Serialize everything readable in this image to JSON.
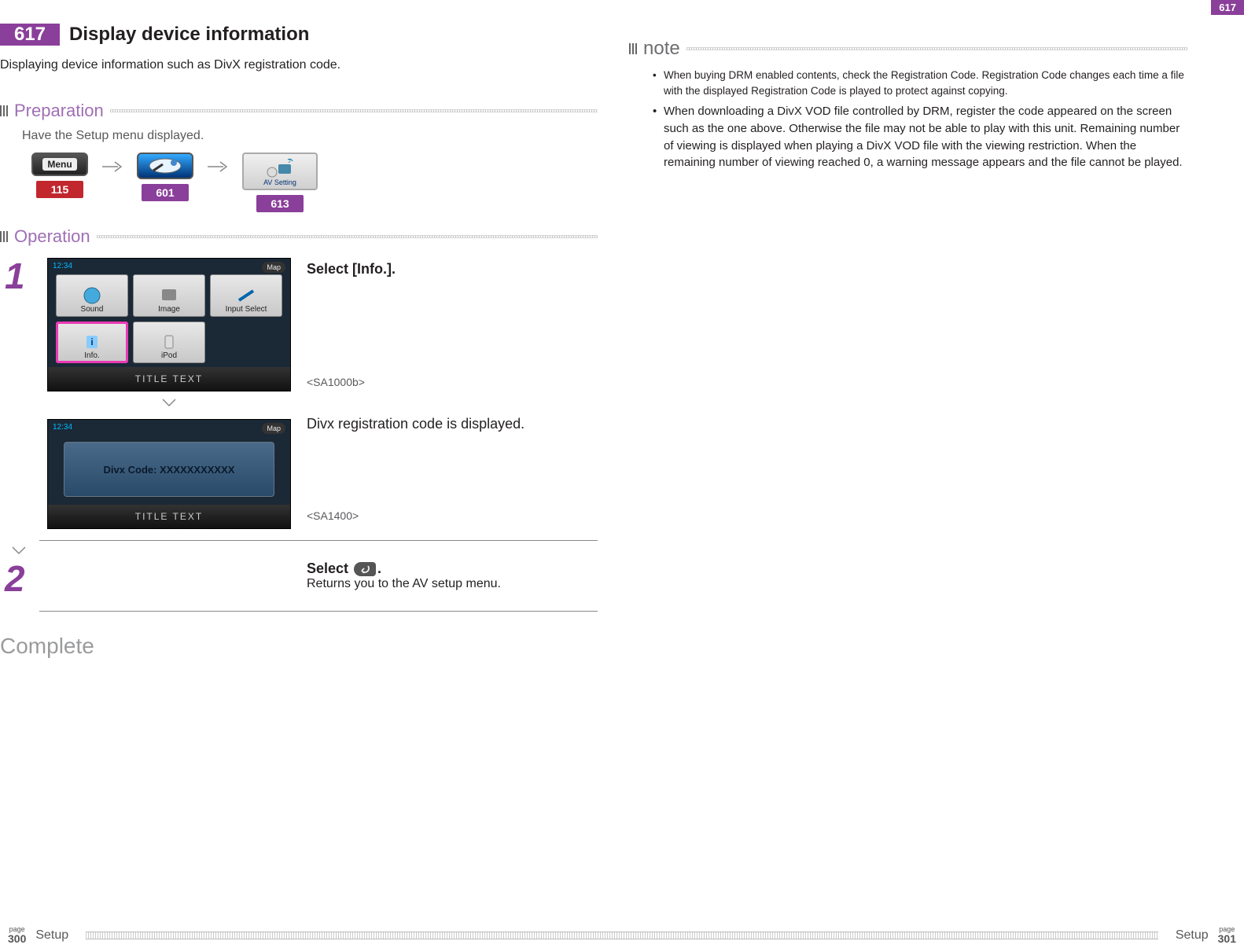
{
  "top_tag": "617",
  "header": {
    "badge": "617",
    "title": "Display device information"
  },
  "intro": "Displaying device information such as DivX registration code.",
  "sections": {
    "preparation_label": "Preparation",
    "preparation_text": "Have the Setup menu displayed.",
    "operation_label": "Operation",
    "note_label": "note",
    "complete_label": "Complete"
  },
  "prep_icons": {
    "menu_label": "Menu",
    "av_label": "AV Setting",
    "ref1": "115",
    "ref2": "601",
    "ref3": "613"
  },
  "screens": {
    "clock": "12:34",
    "map_label": "Map",
    "title_text": "TITLE TEXT",
    "tiles": {
      "sound": "Sound",
      "image": "Image",
      "input": "Input Select",
      "info": "Info.",
      "ipod": "iPod"
    },
    "divx_code_label": "Divx Code:  XXXXXXXXXXX"
  },
  "steps": {
    "s1_num": "1",
    "s1_text": "Select [Info.].",
    "s1_ref": "<SA1000b>",
    "s1b_text": "Divx registration code is displayed.",
    "s1b_ref": "<SA1400>",
    "s2_num": "2",
    "s2_text_a": "Select ",
    "s2_text_b": ".",
    "s2_sub": "Returns you to the AV setup menu."
  },
  "notes": {
    "n1": "When buying DRM enabled contents, check the Registration Code. Registration Code changes each time a file with the displayed Registration Code is played to protect against copying.",
    "n2": "When downloading a DivX VOD file controlled by DRM, register the code appeared on the screen such as the one above. Otherwise the file may not be able to play with this unit. Remaining number of viewing is displayed when playing a DivX VOD file with the viewing restriction. When the remaining number of viewing reached 0, a warning message appears and the file cannot be played."
  },
  "footer": {
    "page_label": "page",
    "left_page": "300",
    "right_page": "301",
    "section": "Setup"
  }
}
